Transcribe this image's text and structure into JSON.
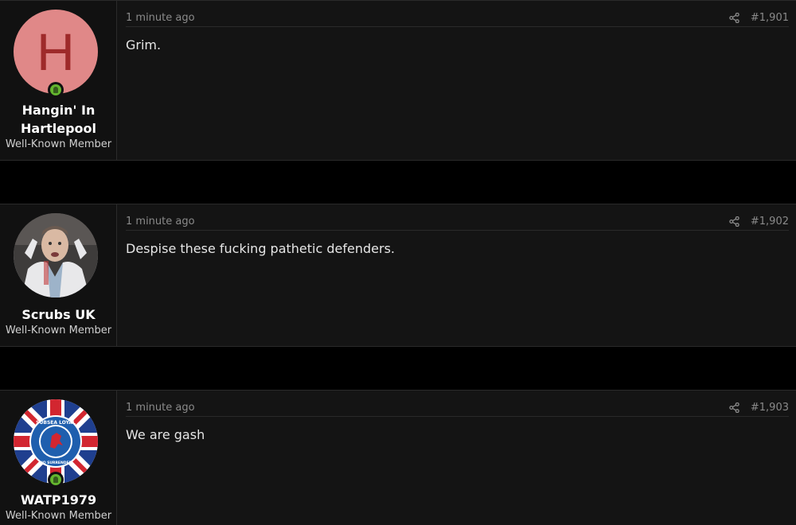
{
  "posts": [
    {
      "user": {
        "name_line1": "Hangin' In",
        "name_line2": "Hartlepool",
        "title": "Well-Known Member",
        "avatar_letter": "H",
        "online": true
      },
      "time": "1 minute ago",
      "number": "#1,901",
      "message": "Grim."
    },
    {
      "user": {
        "name": "Scrubs UK",
        "title": "Well-Known Member",
        "online": false
      },
      "time": "1 minute ago",
      "number": "#1,902",
      "message": "Despise these fucking pathetic defenders."
    },
    {
      "user": {
        "name": "WATP1979",
        "title": "Well-Known Member",
        "online": true,
        "badge_text_top": "SUBSEA LOYAL",
        "badge_text_bottom": "NO SURRENDER"
      },
      "time": "1 minute ago",
      "number": "#1,903",
      "message": "We are gash"
    }
  ],
  "colors": {
    "online": "#63b52e",
    "avatar_bg": "#e08888",
    "avatar_letter": "#9e2a2a"
  }
}
